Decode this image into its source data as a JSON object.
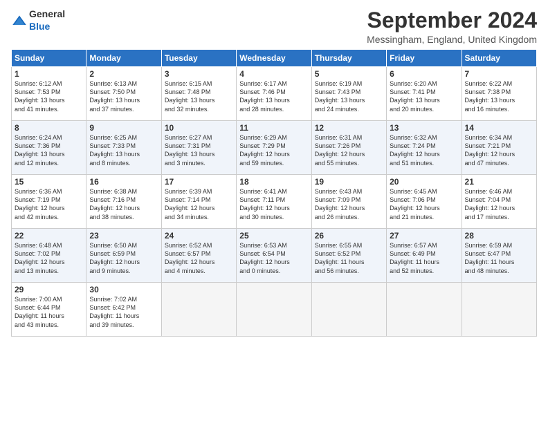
{
  "header": {
    "logo_general": "General",
    "logo_blue": "Blue",
    "title": "September 2024",
    "location": "Messingham, England, United Kingdom"
  },
  "columns": [
    "Sunday",
    "Monday",
    "Tuesday",
    "Wednesday",
    "Thursday",
    "Friday",
    "Saturday"
  ],
  "weeks": [
    [
      {
        "day": "1",
        "detail": "Sunrise: 6:12 AM\nSunset: 7:53 PM\nDaylight: 13 hours\nand 41 minutes."
      },
      {
        "day": "2",
        "detail": "Sunrise: 6:13 AM\nSunset: 7:50 PM\nDaylight: 13 hours\nand 37 minutes."
      },
      {
        "day": "3",
        "detail": "Sunrise: 6:15 AM\nSunset: 7:48 PM\nDaylight: 13 hours\nand 32 minutes."
      },
      {
        "day": "4",
        "detail": "Sunrise: 6:17 AM\nSunset: 7:46 PM\nDaylight: 13 hours\nand 28 minutes."
      },
      {
        "day": "5",
        "detail": "Sunrise: 6:19 AM\nSunset: 7:43 PM\nDaylight: 13 hours\nand 24 minutes."
      },
      {
        "day": "6",
        "detail": "Sunrise: 6:20 AM\nSunset: 7:41 PM\nDaylight: 13 hours\nand 20 minutes."
      },
      {
        "day": "7",
        "detail": "Sunrise: 6:22 AM\nSunset: 7:38 PM\nDaylight: 13 hours\nand 16 minutes."
      }
    ],
    [
      {
        "day": "8",
        "detail": "Sunrise: 6:24 AM\nSunset: 7:36 PM\nDaylight: 13 hours\nand 12 minutes."
      },
      {
        "day": "9",
        "detail": "Sunrise: 6:25 AM\nSunset: 7:33 PM\nDaylight: 13 hours\nand 8 minutes."
      },
      {
        "day": "10",
        "detail": "Sunrise: 6:27 AM\nSunset: 7:31 PM\nDaylight: 13 hours\nand 3 minutes."
      },
      {
        "day": "11",
        "detail": "Sunrise: 6:29 AM\nSunset: 7:29 PM\nDaylight: 12 hours\nand 59 minutes."
      },
      {
        "day": "12",
        "detail": "Sunrise: 6:31 AM\nSunset: 7:26 PM\nDaylight: 12 hours\nand 55 minutes."
      },
      {
        "day": "13",
        "detail": "Sunrise: 6:32 AM\nSunset: 7:24 PM\nDaylight: 12 hours\nand 51 minutes."
      },
      {
        "day": "14",
        "detail": "Sunrise: 6:34 AM\nSunset: 7:21 PM\nDaylight: 12 hours\nand 47 minutes."
      }
    ],
    [
      {
        "day": "15",
        "detail": "Sunrise: 6:36 AM\nSunset: 7:19 PM\nDaylight: 12 hours\nand 42 minutes."
      },
      {
        "day": "16",
        "detail": "Sunrise: 6:38 AM\nSunset: 7:16 PM\nDaylight: 12 hours\nand 38 minutes."
      },
      {
        "day": "17",
        "detail": "Sunrise: 6:39 AM\nSunset: 7:14 PM\nDaylight: 12 hours\nand 34 minutes."
      },
      {
        "day": "18",
        "detail": "Sunrise: 6:41 AM\nSunset: 7:11 PM\nDaylight: 12 hours\nand 30 minutes."
      },
      {
        "day": "19",
        "detail": "Sunrise: 6:43 AM\nSunset: 7:09 PM\nDaylight: 12 hours\nand 26 minutes."
      },
      {
        "day": "20",
        "detail": "Sunrise: 6:45 AM\nSunset: 7:06 PM\nDaylight: 12 hours\nand 21 minutes."
      },
      {
        "day": "21",
        "detail": "Sunrise: 6:46 AM\nSunset: 7:04 PM\nDaylight: 12 hours\nand 17 minutes."
      }
    ],
    [
      {
        "day": "22",
        "detail": "Sunrise: 6:48 AM\nSunset: 7:02 PM\nDaylight: 12 hours\nand 13 minutes."
      },
      {
        "day": "23",
        "detail": "Sunrise: 6:50 AM\nSunset: 6:59 PM\nDaylight: 12 hours\nand 9 minutes."
      },
      {
        "day": "24",
        "detail": "Sunrise: 6:52 AM\nSunset: 6:57 PM\nDaylight: 12 hours\nand 4 minutes."
      },
      {
        "day": "25",
        "detail": "Sunrise: 6:53 AM\nSunset: 6:54 PM\nDaylight: 12 hours\nand 0 minutes."
      },
      {
        "day": "26",
        "detail": "Sunrise: 6:55 AM\nSunset: 6:52 PM\nDaylight: 11 hours\nand 56 minutes."
      },
      {
        "day": "27",
        "detail": "Sunrise: 6:57 AM\nSunset: 6:49 PM\nDaylight: 11 hours\nand 52 minutes."
      },
      {
        "day": "28",
        "detail": "Sunrise: 6:59 AM\nSunset: 6:47 PM\nDaylight: 11 hours\nand 48 minutes."
      }
    ],
    [
      {
        "day": "29",
        "detail": "Sunrise: 7:00 AM\nSunset: 6:44 PM\nDaylight: 11 hours\nand 43 minutes."
      },
      {
        "day": "30",
        "detail": "Sunrise: 7:02 AM\nSunset: 6:42 PM\nDaylight: 11 hours\nand 39 minutes."
      },
      {
        "day": "",
        "detail": ""
      },
      {
        "day": "",
        "detail": ""
      },
      {
        "day": "",
        "detail": ""
      },
      {
        "day": "",
        "detail": ""
      },
      {
        "day": "",
        "detail": ""
      }
    ]
  ]
}
